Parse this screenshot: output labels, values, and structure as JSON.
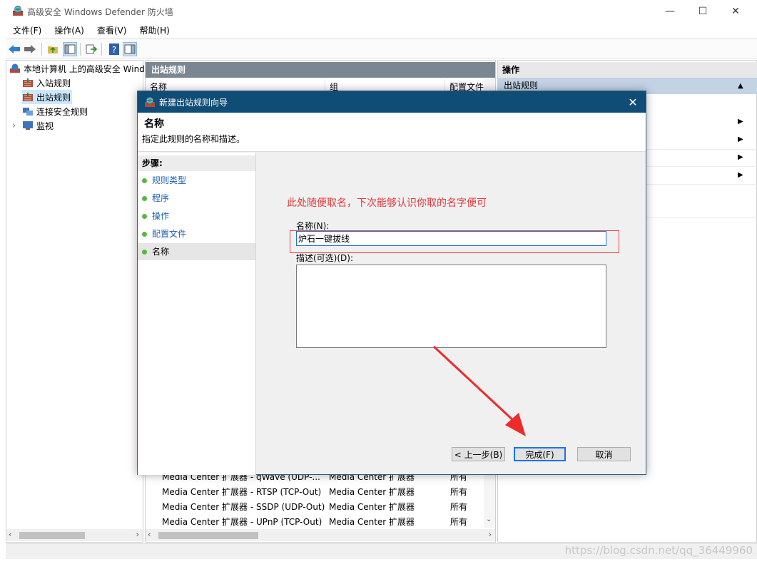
{
  "window": {
    "title": "高级安全 Windows Defender 防火墙",
    "controls": {
      "minimize": "—",
      "maximize": "☐",
      "close": "✕"
    }
  },
  "menu": [
    "文件(F)",
    "操作(A)",
    "查看(V)",
    "帮助(H)"
  ],
  "tree": {
    "root": "本地计算机 上的高级安全 Windows",
    "items": [
      "入站规则",
      "出站规则",
      "连接安全规则",
      "监视"
    ],
    "expander": "›"
  },
  "center": {
    "title": "出站规则",
    "columns": [
      "名称",
      "组",
      "配置文件"
    ],
    "rows": [
      [
        "Media Center 扩展器 - qWave (UDP-...",
        "Media Center 扩展器",
        "所有"
      ],
      [
        "Media Center 扩展器 - RTSP (TCP-Out)",
        "Media Center 扩展器",
        "所有"
      ],
      [
        "Media Center 扩展器 - SSDP (UDP-Out)",
        "Media Center 扩展器",
        "所有"
      ],
      [
        "Media Center 扩展器 - UPnP (TCP-Out)",
        "Media Center 扩展器",
        "所有"
      ]
    ]
  },
  "actions": {
    "title": "操作",
    "section": "出站规则",
    "arrow": "▲",
    "submenu_arrow": "▶"
  },
  "dialog": {
    "title": "新建出站规则向导",
    "heading": "名称",
    "subtitle": "指定此规则的名称和描述。",
    "steps_title": "步骤:",
    "steps": [
      "规则类型",
      "程序",
      "操作",
      "配置文件",
      "名称"
    ],
    "annotation": "此处随便取名，下次能够认识你取的名字便可",
    "name_label": "名称(N):",
    "name_value": "炉石一键拔线",
    "desc_label": "描述(可选)(D):",
    "desc_value": "",
    "buttons": {
      "back": "< 上一步(B)",
      "finish": "完成(F)",
      "cancel": "取消"
    },
    "close": "✕"
  },
  "watermark": "https://blog.csdn.net/qq_36449960",
  "colors": {
    "dialog_title_bg": "#0f4c76",
    "annotation": "#e8383a",
    "step_link": "#1b5fb0",
    "step_dot": "#55b93d",
    "selection": "#cce8ff"
  }
}
